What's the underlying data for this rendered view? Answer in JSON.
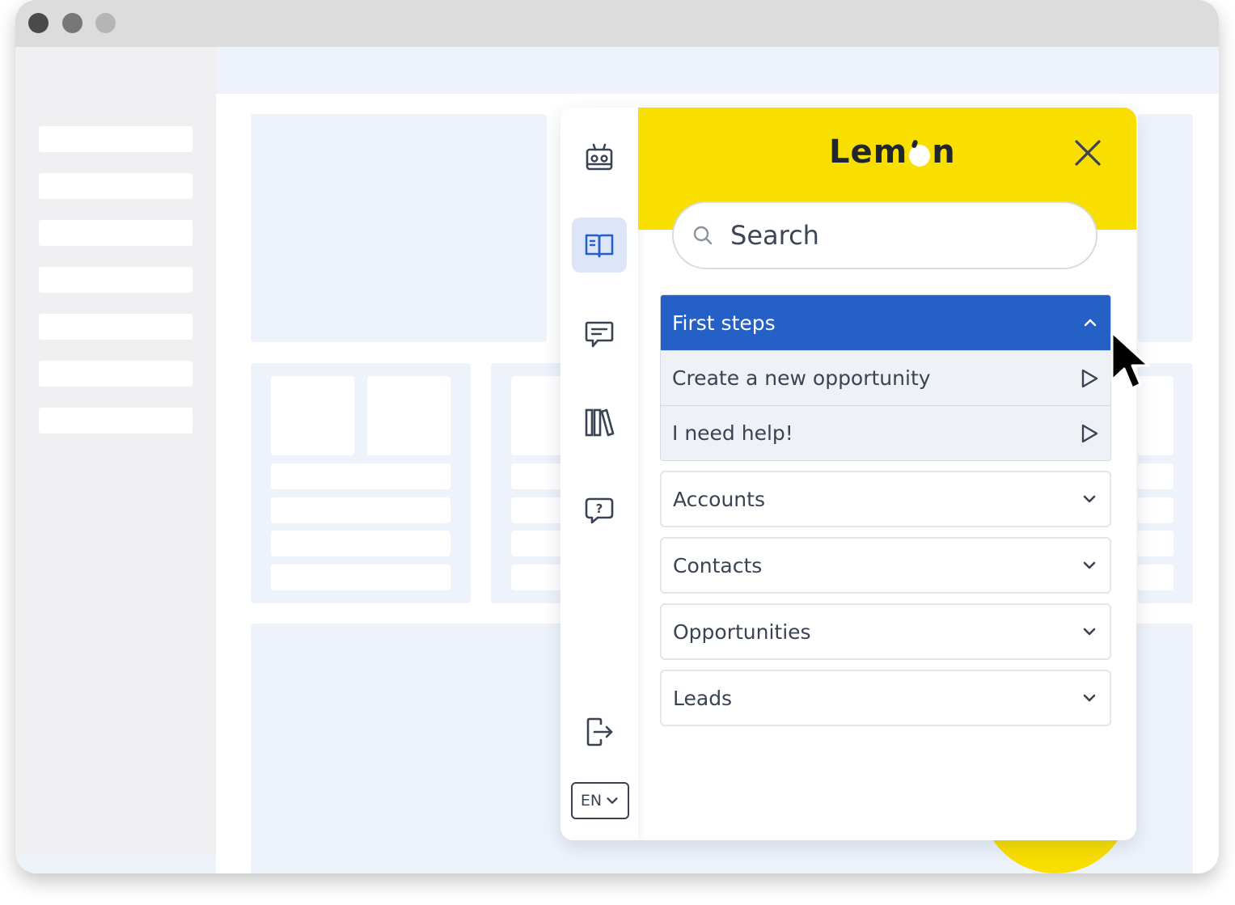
{
  "widget": {
    "brand": "Lemon",
    "brand_parts": {
      "before": "Lem",
      "after": "n"
    },
    "search": {
      "placeholder": "Search"
    },
    "rail": {
      "items": [
        {
          "icon": "robot-icon",
          "active": false
        },
        {
          "icon": "book-icon",
          "active": true
        },
        {
          "icon": "chat-icon",
          "active": false
        },
        {
          "icon": "library-icon",
          "active": false
        },
        {
          "icon": "help-chat-icon",
          "active": false
        },
        {
          "icon": "logout-icon",
          "active": false
        }
      ],
      "language": "EN"
    },
    "sections": [
      {
        "label": "First steps",
        "expanded": true,
        "items": [
          {
            "label": "Create a new opportunity"
          },
          {
            "label": "I need help!"
          }
        ]
      },
      {
        "label": "Accounts",
        "expanded": false
      },
      {
        "label": "Contacts",
        "expanded": false
      },
      {
        "label": "Opportunities",
        "expanded": false
      },
      {
        "label": "Leads",
        "expanded": false
      }
    ]
  },
  "colors": {
    "brand_yellow": "#f9df00",
    "accent_blue": "#2560c6",
    "text_dark": "#3a4352"
  }
}
